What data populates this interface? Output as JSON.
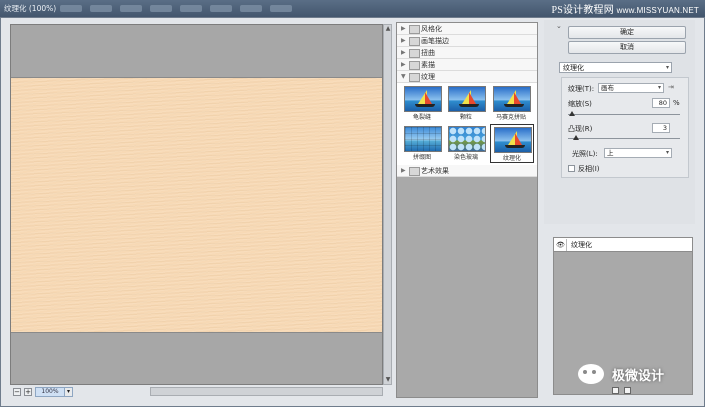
{
  "window": {
    "title": "纹理化 (100%)"
  },
  "watermark_top": {
    "text": "PS设计教程网",
    "url": "www.MISSYUAN.NET"
  },
  "watermark_bottom": {
    "text": "极微设计"
  },
  "preview": {
    "zoom": "100%"
  },
  "gallery": {
    "categories": [
      {
        "label": "风格化",
        "expanded": false
      },
      {
        "label": "画笔描边",
        "expanded": false
      },
      {
        "label": "扭曲",
        "expanded": false
      },
      {
        "label": "素描",
        "expanded": false
      },
      {
        "label": "纹理",
        "expanded": true
      },
      {
        "label": "艺术效果",
        "expanded": false
      }
    ],
    "texture_filters": [
      {
        "label": "龟裂缝"
      },
      {
        "label": "颗粒"
      },
      {
        "label": "马赛克拼贴"
      },
      {
        "label": "拼缀图"
      },
      {
        "label": "染色玻璃"
      },
      {
        "label": "纹理化",
        "selected": true
      }
    ]
  },
  "buttons": {
    "ok": "确定",
    "cancel": "取消"
  },
  "filter_select": {
    "value": "纹理化"
  },
  "settings": {
    "texture_label": "纹理(T):",
    "texture_value": "画布",
    "scale_label": "缩放(S)",
    "scale_value": "80",
    "scale_unit": "%",
    "relief_label": "凸现(R)",
    "relief_value": "3",
    "light_label": "光照(L):",
    "light_value": "上",
    "invert_label": "反相(I)",
    "invert_checked": false
  },
  "layers": {
    "items": [
      {
        "label": "纹理化"
      }
    ]
  },
  "colors": {
    "canvas": "#f7d9b5",
    "titlebar": "#4d6079"
  }
}
